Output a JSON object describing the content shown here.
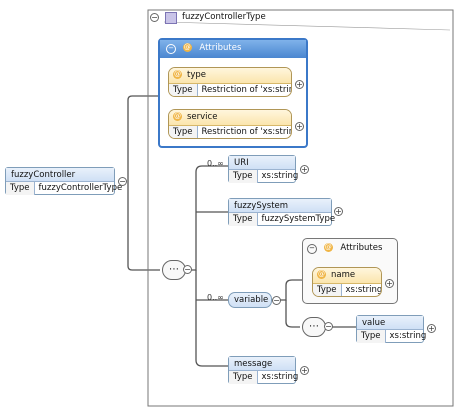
{
  "complex_type": {
    "name": "fuzzyControllerType"
  },
  "attributes_group": {
    "title": "Attributes",
    "items": [
      {
        "name": "type",
        "type_key": "Type",
        "type_value": "Restriction of 'xs:string'"
      },
      {
        "name": "service",
        "type_key": "Type",
        "type_value": "Restriction of 'xs:string'"
      }
    ]
  },
  "root_element": {
    "name": "fuzzyController",
    "type_key": "Type",
    "type_value": "fuzzyControllerType"
  },
  "sequence_children": [
    {
      "name": "URI",
      "multiplicity": "0..∞",
      "type_key": "Type",
      "type_value": "xs:string"
    },
    {
      "name": "fuzzySystem",
      "multiplicity": "",
      "type_key": "Type",
      "type_value": "fuzzySystemType"
    },
    {
      "name": "variable",
      "multiplicity": "0..∞"
    },
    {
      "name": "message",
      "multiplicity": "",
      "type_key": "Type",
      "type_value": "xs:string"
    }
  ],
  "variable_attributes": {
    "title": "Attributes",
    "name": "name",
    "type_key": "Type",
    "type_value": "xs:string"
  },
  "variable_value": {
    "name": "value",
    "type_key": "Type",
    "type_value": "xs:string"
  },
  "icons": {
    "collapse": "minus",
    "expand": "plus",
    "attribute": "@"
  },
  "colors": {
    "accent": "#3b78c8",
    "element_fill": "#dbe8f7",
    "attribute_fill": "#fbe7b8"
  }
}
